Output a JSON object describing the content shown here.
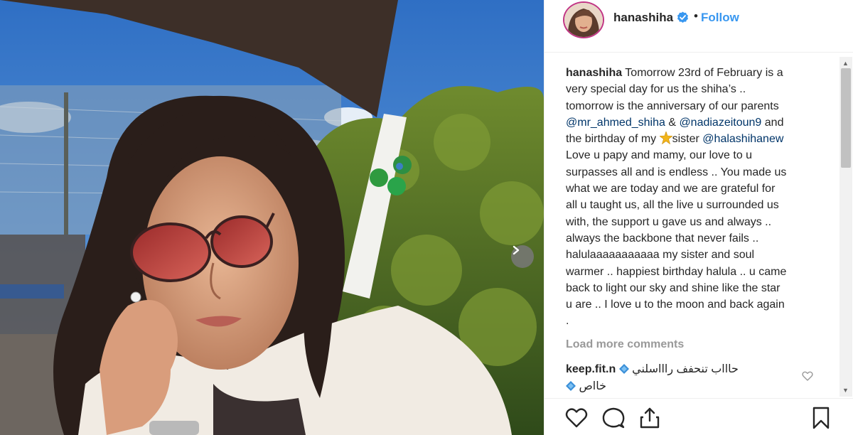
{
  "post": {
    "username": "hanashiha",
    "separator": "•",
    "follow_label": "Follow",
    "caption_username": "hanashiha",
    "caption_lines": [
      "Tomorrow 23rd of February is a",
      "very special day for us the shiha’s ..",
      "tomorrow is the anniversary of our parents"
    ],
    "mention_1": "@mr_ahmed_shiha",
    "amp": " & ",
    "mention_2": "@nadiazeitoun9",
    "and_text": " and",
    "birthday_prefix": "the birthday of my ",
    "sister_word": "sister ",
    "mention_3": "@halashihanew",
    "body_lines": [
      "Love u papy and mamy, our love to u",
      "surpasses all and is endless .. You made us",
      "what we are today and we are grateful for",
      "all u taught us, all the live u surrounded us",
      "with, the support u gave us and always ..",
      "always the backbone that never fails ..",
      "halulaaaaaaaaaaa my sister and soul",
      "warmer .. happiest birthday halula .. u came",
      "back to light our sky and shine like the star",
      "u are .. I love u to the moon and back again",
      "."
    ],
    "load_more": "Load more comments"
  },
  "comment": {
    "username": "keep.fit.n",
    "text_line1": "حاااب تنحفف راااسلني",
    "text_line2": "خااص"
  },
  "icons": {
    "verified": "verified-badge-icon",
    "like": "heart-icon",
    "comment": "comment-icon",
    "share": "share-icon",
    "save": "bookmark-icon",
    "next": "chevron-right-icon"
  },
  "colors": {
    "link": "#3897f0",
    "mention": "#003569",
    "muted": "#999999",
    "border": "#efefef"
  }
}
